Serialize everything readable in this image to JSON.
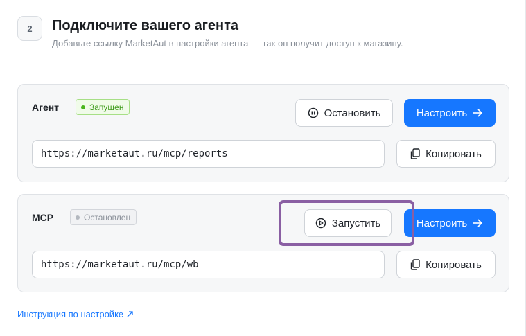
{
  "step": {
    "number": "2",
    "title": "Подключите вашего агента",
    "subtitle": "Добавьте ссылку MarketAut в настройки агента — так он получит доступ к магазину."
  },
  "cards": [
    {
      "name": "Агент",
      "status": "Запущен",
      "status_color": "#49b51c",
      "action_label": "Остановить",
      "action_icon": "pause-circle-icon",
      "configure_label": "Настроить",
      "url": "https://marketaut.ru/mcp/reports",
      "copy_label": "Копировать"
    },
    {
      "name": "MCP",
      "status": "Остановлен",
      "status_color": "#b3b8bf",
      "action_label": "Запустить",
      "action_icon": "play-circle-icon",
      "configure_label": "Настроить",
      "url": "https://marketaut.ru/mcp/wb",
      "copy_label": "Копировать"
    }
  ],
  "help_link": "Инструкция по настройке",
  "colors": {
    "primary": "#1677ff",
    "highlight": "#8a5fa3"
  }
}
